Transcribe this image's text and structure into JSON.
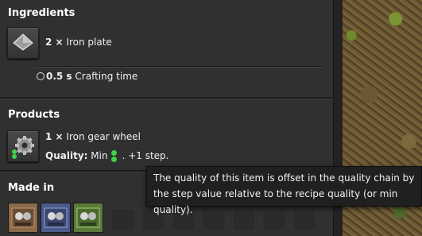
{
  "ingredients": {
    "title": "Ingredients",
    "items": [
      {
        "amount": "2 ×",
        "name": "Iron plate",
        "icon": "iron-plate-icon"
      }
    ],
    "time_value": "0.5 s",
    "time_label": "Crafting time"
  },
  "products": {
    "title": "Products",
    "items": [
      {
        "amount": "1 ×",
        "name": "Iron gear wheel",
        "icon": "iron-gear-wheel-icon"
      }
    ],
    "quality_label": "Quality:",
    "quality_value": "Min",
    "quality_step": ". +1 step."
  },
  "made_in": {
    "title": "Made in",
    "machines": [
      {
        "icon": "assembling-machine-1-icon",
        "color": "#8a6a4a"
      },
      {
        "icon": "assembling-machine-2-icon",
        "color": "#4a5a8a"
      },
      {
        "icon": "assembling-machine-3-icon",
        "color": "#5a7a3a"
      }
    ]
  },
  "tooltip": {
    "text": "The quality of this item is offset in the quality chain by the step value relative to the recipe quality (or min quality)."
  },
  "colors": {
    "panel": "#313031",
    "quality_green": "#3fd14a",
    "tooltip_bg": "#202020"
  }
}
